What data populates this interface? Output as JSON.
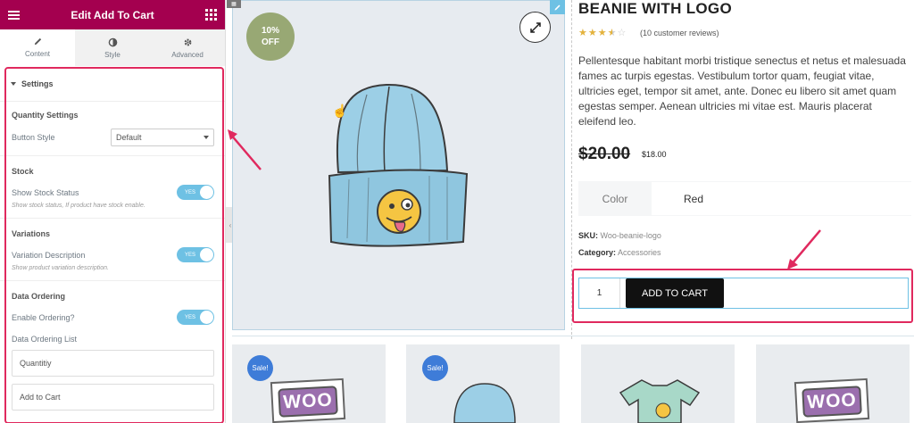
{
  "panel": {
    "title": "Edit Add To Cart",
    "tabs": [
      {
        "label": "Content",
        "icon": "pencil-icon"
      },
      {
        "label": "Style",
        "icon": "contrast-icon"
      },
      {
        "label": "Advanced",
        "icon": "gear-icon"
      }
    ],
    "section_title": "Settings",
    "quantity_group": "Quantity Settings",
    "button_style_label": "Button Style",
    "button_style_value": "Default",
    "stock_group": "Stock",
    "show_stock_label": "Show Stock Status",
    "show_stock_hint": "Show stock status, If product have stock enable.",
    "variations_group": "Variations",
    "variation_desc_label": "Variation Description",
    "variation_desc_hint": "Show product variation description.",
    "ordering_group": "Data Ordering",
    "enable_ordering_label": "Enable Ordering?",
    "ordering_list_label": "Data Ordering List",
    "ordering_items": [
      "Quantitiy",
      "Add to Cart"
    ],
    "toggle_text": "YES"
  },
  "product": {
    "badge_line1": "10%",
    "badge_line2": "OFF",
    "title": "BEANIE WITH LOGO",
    "rating": 3.5,
    "reviews": "(10 customer reviews)",
    "description": "Pellentesque habitant morbi tristique senectus et netus et malesuada fames ac turpis egestas. Vestibulum tortor quam, feugiat vitae, ultricies eget, tempor sit amet, ante. Donec eu libero sit amet quam egestas semper. Aenean ultricies mi vitae est. Mauris placerat eleifend leo.",
    "old_price": "$20.00",
    "new_price": "$18.00",
    "attr_name": "Color",
    "attr_value": "Red",
    "sku_label": "SKU:",
    "sku_value": "Woo-beanie-logo",
    "category_label": "Category:",
    "category_value": "Accessories",
    "qty": "1",
    "add_to_cart": "ADD TO CART"
  },
  "related": {
    "sale_label": "Sale!",
    "woo_text": "WOO"
  },
  "colors": {
    "brand": "#a4004f",
    "highlight": "#e0295e",
    "toggle": "#6ec1e4",
    "badge": "#98a874",
    "sale": "#3e7cd8"
  }
}
